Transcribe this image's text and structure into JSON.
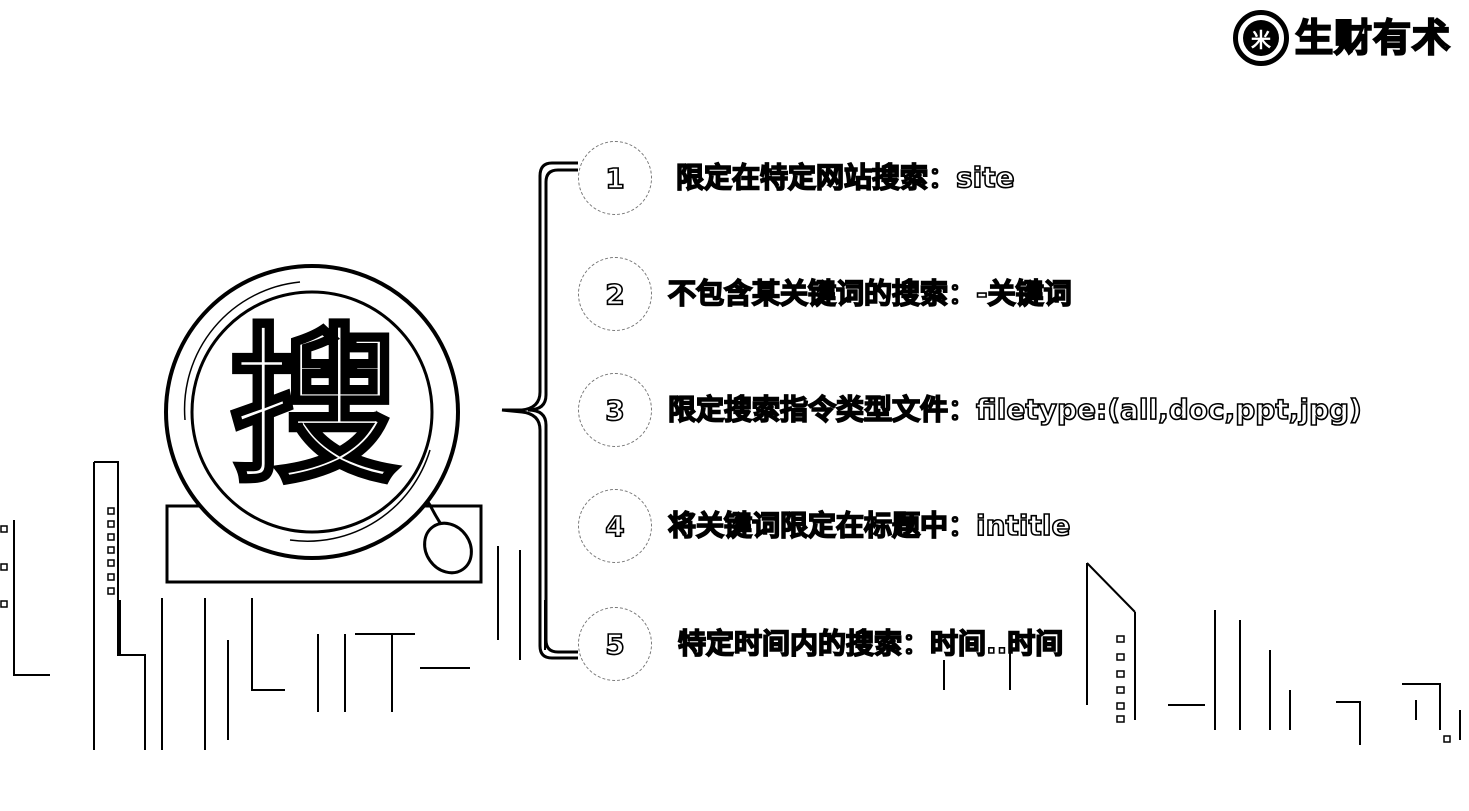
{
  "logo": {
    "icon_char": "米",
    "text": "生财有术"
  },
  "center_icon": {
    "name": "magnifier-icon",
    "char": "搜"
  },
  "items": [
    {
      "number": "1",
      "text": "限定在特定网站搜索：site"
    },
    {
      "number": "2",
      "text": "不包含某关键词的搜索：-关键词"
    },
    {
      "number": "3",
      "text": "限定搜索指令类型文件：filetype:(all,doc,ppt,jpg)"
    },
    {
      "number": "4",
      "text": "将关键词限定在标题中：intitle"
    },
    {
      "number": "5",
      "text": "特定时间内的搜索：时间..时间"
    }
  ]
}
